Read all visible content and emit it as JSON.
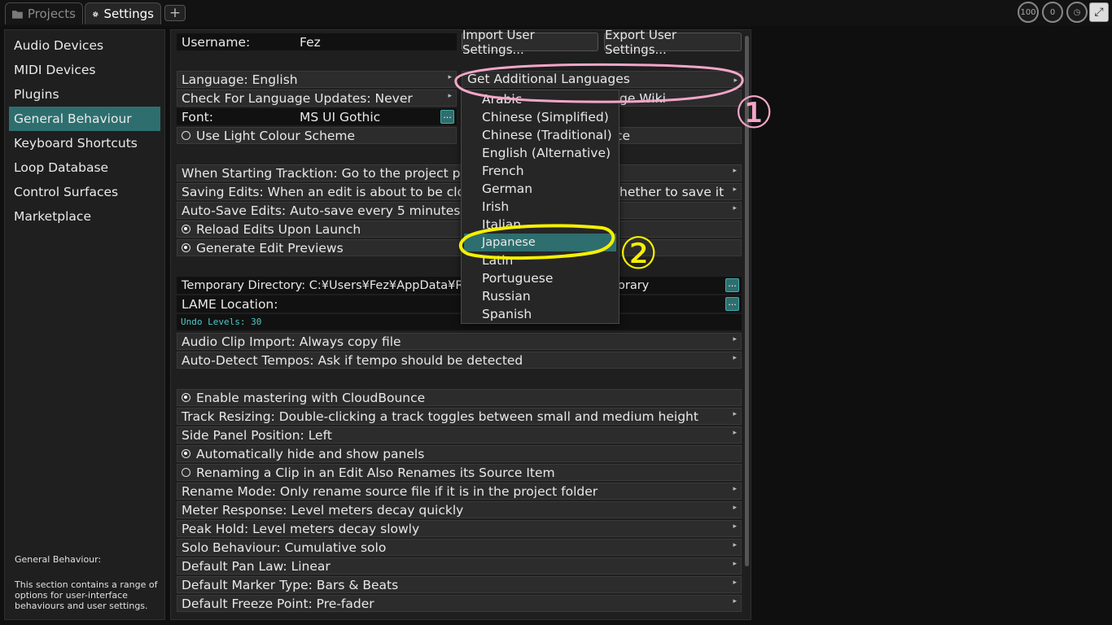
{
  "tabs": [
    {
      "label": "Projects"
    },
    {
      "label": "Settings"
    }
  ],
  "add_tab_label": "+",
  "meters": [
    "100",
    "0"
  ],
  "sidebar": {
    "items": [
      {
        "label": "Audio Devices"
      },
      {
        "label": "MIDI Devices"
      },
      {
        "label": "Plugins"
      },
      {
        "label": "General Behaviour"
      },
      {
        "label": "Keyboard Shortcuts"
      },
      {
        "label": "Loop Database"
      },
      {
        "label": "Control Surfaces"
      },
      {
        "label": "Marketplace"
      }
    ],
    "description_title": "General Behaviour:",
    "description": "This section contains a range of options for user-interface behaviours and user settings."
  },
  "settings": {
    "username_label": "Username:",
    "username_value": "Fez",
    "import_button": "Import User Settings...",
    "export_button": "Export User Settings...",
    "language": "Language: English",
    "language_updates": "Check For Language Updates: Never",
    "font_label": "Font:",
    "font_value": "MS UI Gothic",
    "light_colour": "Use Light Colour Scheme",
    "light_colour_suffix": "ce",
    "language_wiki_suffix": "ge Wiki",
    "starting": "When Starting Tracktion: Go to the project pa",
    "saving": "Saving Edits: When an edit is about to be clos",
    "saving_suffix": "hether to save it",
    "autosave": "Auto-Save Edits: Auto-save every 5 minutes",
    "reload": "Reload Edits Upon Launch",
    "previews": "Generate Edit Previews",
    "temp_dir": "Temporary Directory: C:¥Users¥Fez¥AppData¥Ro",
    "temp_dir_suffix": "orary",
    "lame": "LAME Location:",
    "undo": "Undo Levels: 30",
    "audio_clip": "Audio Clip Import: Always copy file",
    "auto_detect": "Auto-Detect Tempos: Ask if tempo should be detected",
    "mastering": "Enable mastering with CloudBounce",
    "track_resizing": "Track Resizing: Double-clicking a track toggles between small and medium height",
    "side_panel": "Side Panel Position: Left",
    "auto_hide": "Automatically hide and show panels",
    "renaming": "Renaming a Clip in an Edit Also Renames its Source Item",
    "rename_mode": "Rename Mode: Only rename source file if it is in the project folder",
    "meter_response": "Meter Response: Level meters decay quickly",
    "peak_hold": "Peak Hold: Level meters decay slowly",
    "solo": "Solo Behaviour: Cumulative solo",
    "pan_law": "Default Pan Law: Linear",
    "marker_type": "Default Marker Type: Bars & Beats",
    "freeze_point": "Default Freeze Point: Pre-fader",
    "dots": "..."
  },
  "language_menu": {
    "get_additional": "Get Additional Languages",
    "items": [
      "Arabic",
      "Chinese (Simplified)",
      "Chinese (Traditional)",
      "English (Alternative)",
      "French",
      "German",
      "Irish",
      "Italian",
      "Japanese",
      "Latin",
      "Portuguese",
      "Russian",
      "Spanish"
    ],
    "selected": "Japanese"
  },
  "annotations": {
    "marker1": "①",
    "marker2": "②",
    "marker1_color": "#f4a6c8",
    "marker2_color": "#f5f000"
  },
  "colors": {
    "accent": "#2e6e6e",
    "undo_text": "#4fc9c9"
  }
}
